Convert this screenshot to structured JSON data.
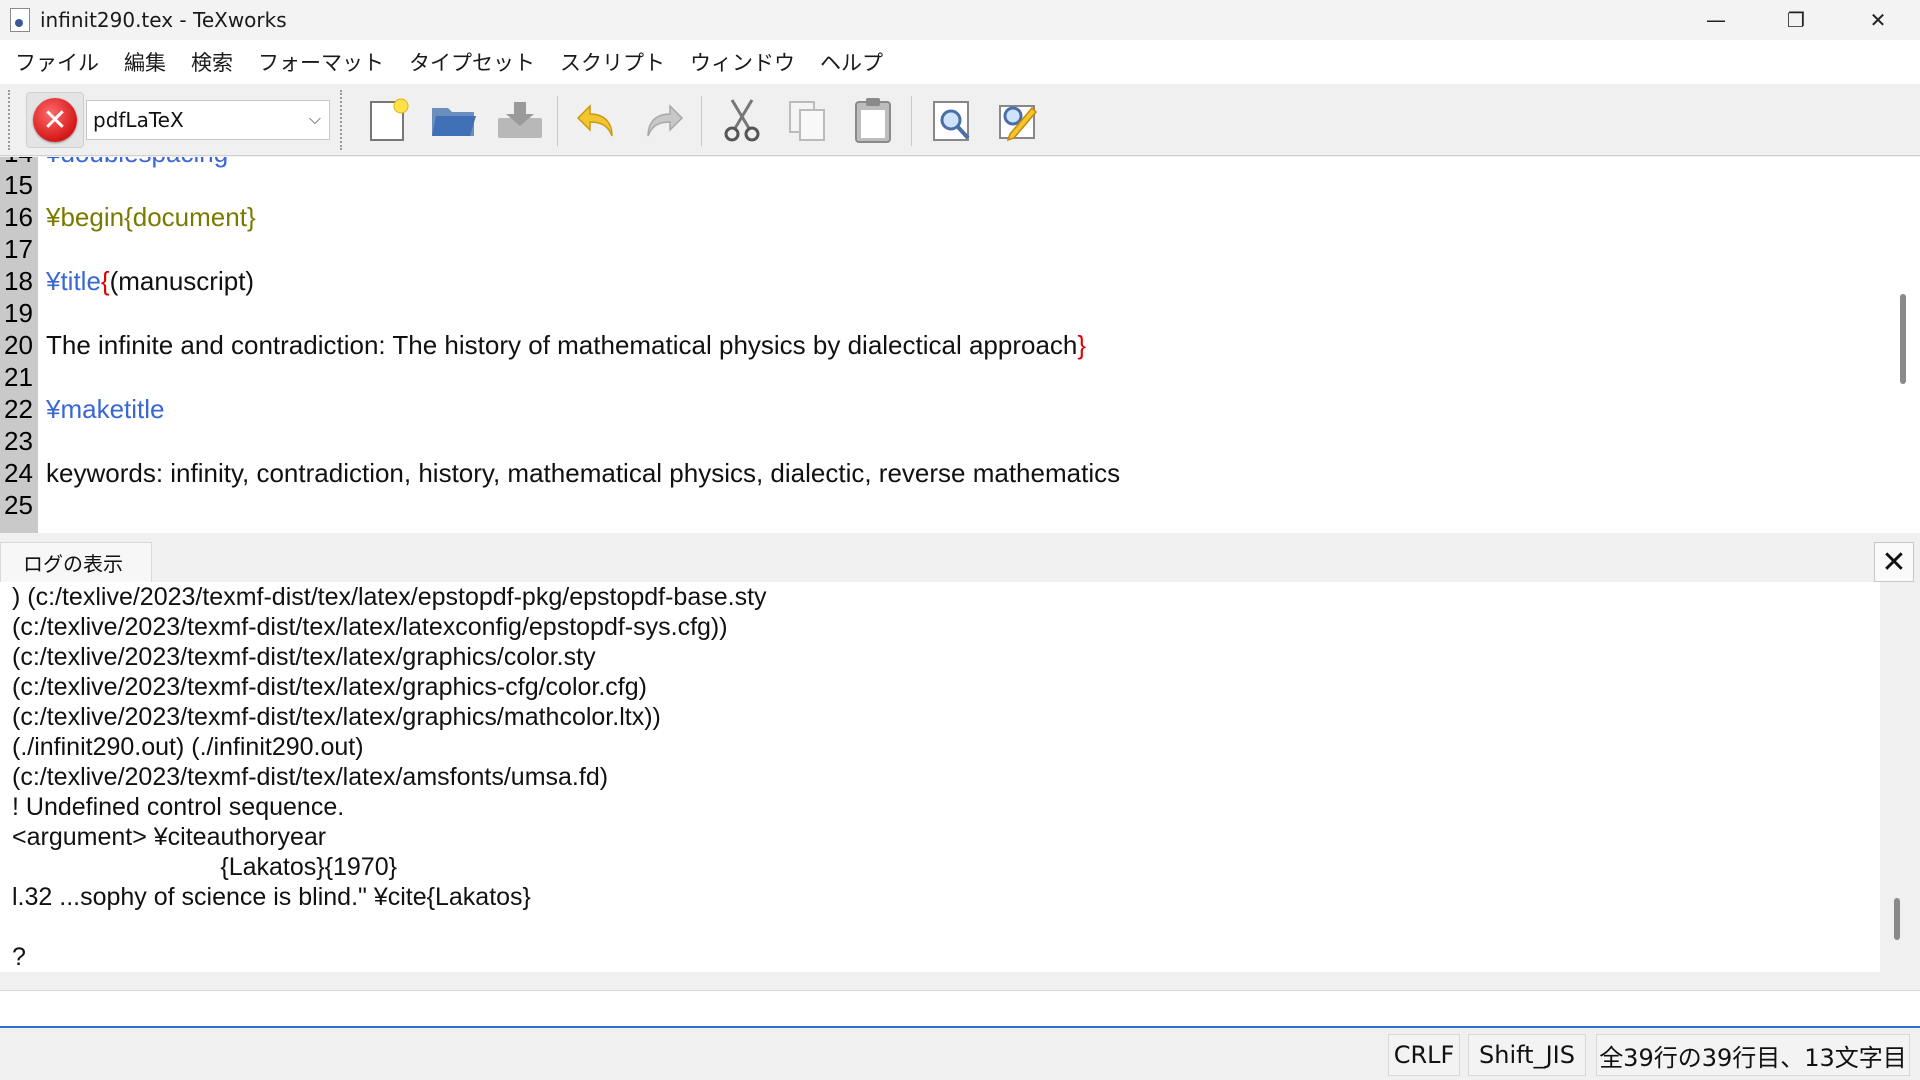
{
  "window": {
    "title": "infinit290.tex - TeXworks",
    "controls": {
      "minimize": "—",
      "maximize": "❐",
      "close": "✕"
    }
  },
  "menu": {
    "items": [
      "ファイル",
      "編集",
      "検索",
      "フォーマット",
      "タイプセット",
      "スクリプト",
      "ウィンドウ",
      "ヘルプ"
    ]
  },
  "toolbar": {
    "typeset_icon": "stop-typeset-icon",
    "engine": "pdfLaTeX",
    "icons": [
      "new-document-icon",
      "open-folder-icon",
      "save-icon",
      "undo-icon",
      "redo-icon",
      "cut-icon",
      "copy-icon",
      "paste-icon",
      "preview-icon",
      "edit-settings-icon"
    ]
  },
  "editor": {
    "partial_top_line": "¥doublespacing",
    "lines": [
      {
        "num": "15",
        "segments": []
      },
      {
        "num": "16",
        "segments": [
          {
            "t": "¥begin{document}",
            "c": "env"
          }
        ]
      },
      {
        "num": "17",
        "segments": []
      },
      {
        "num": "18",
        "segments": [
          {
            "t": "¥title",
            "c": "kw"
          },
          {
            "t": "{",
            "c": "brace"
          },
          {
            "t": "(manuscript)",
            "c": "txt"
          }
        ]
      },
      {
        "num": "19",
        "segments": []
      },
      {
        "num": "20",
        "segments": [
          {
            "t": "The infinite and contradiction: The history of mathematical physics by dialectical approach",
            "c": "txt"
          },
          {
            "t": "}",
            "c": "brace"
          }
        ]
      },
      {
        "num": "21",
        "segments": []
      },
      {
        "num": "22",
        "segments": [
          {
            "t": "¥maketitle",
            "c": "kw"
          }
        ]
      },
      {
        "num": "23",
        "segments": []
      },
      {
        "num": "24",
        "segments": [
          {
            "t": "keywords: infinity, contradiction, history, mathematical physics, dialectic, reverse mathematics",
            "c": "txt"
          }
        ]
      },
      {
        "num": "25",
        "segments": []
      }
    ],
    "colors": {
      "kw": "#3a66d6",
      "env": "#7a7a00",
      "brace": "#e00000",
      "txt": "#111111"
    }
  },
  "log": {
    "tab_label": "ログの表示",
    "lines": [
      ") (c:/texlive/2023/texmf-dist/tex/latex/epstopdf-pkg/epstopdf-base.sty",
      "(c:/texlive/2023/texmf-dist/tex/latex/latexconfig/epstopdf-sys.cfg))",
      "(c:/texlive/2023/texmf-dist/tex/latex/graphics/color.sty",
      "(c:/texlive/2023/texmf-dist/tex/latex/graphics-cfg/color.cfg)",
      "(c:/texlive/2023/texmf-dist/tex/latex/graphics/mathcolor.ltx))",
      "(./infinit290.out) (./infinit290.out)",
      "(c:/texlive/2023/texmf-dist/tex/latex/amsfonts/umsa.fd)",
      "! Undefined control sequence.",
      "<argument> ¥citeauthoryear",
      "                              {Lakatos}{1970}",
      "l.32 ...sophy of science is blind.\" ¥cite{Lakatos}",
      "",
      "?"
    ]
  },
  "console": {
    "value": ""
  },
  "status": {
    "line_ending": "CRLF",
    "encoding": "Shift_JIS",
    "position": "全39行の39行目、13文字目"
  }
}
